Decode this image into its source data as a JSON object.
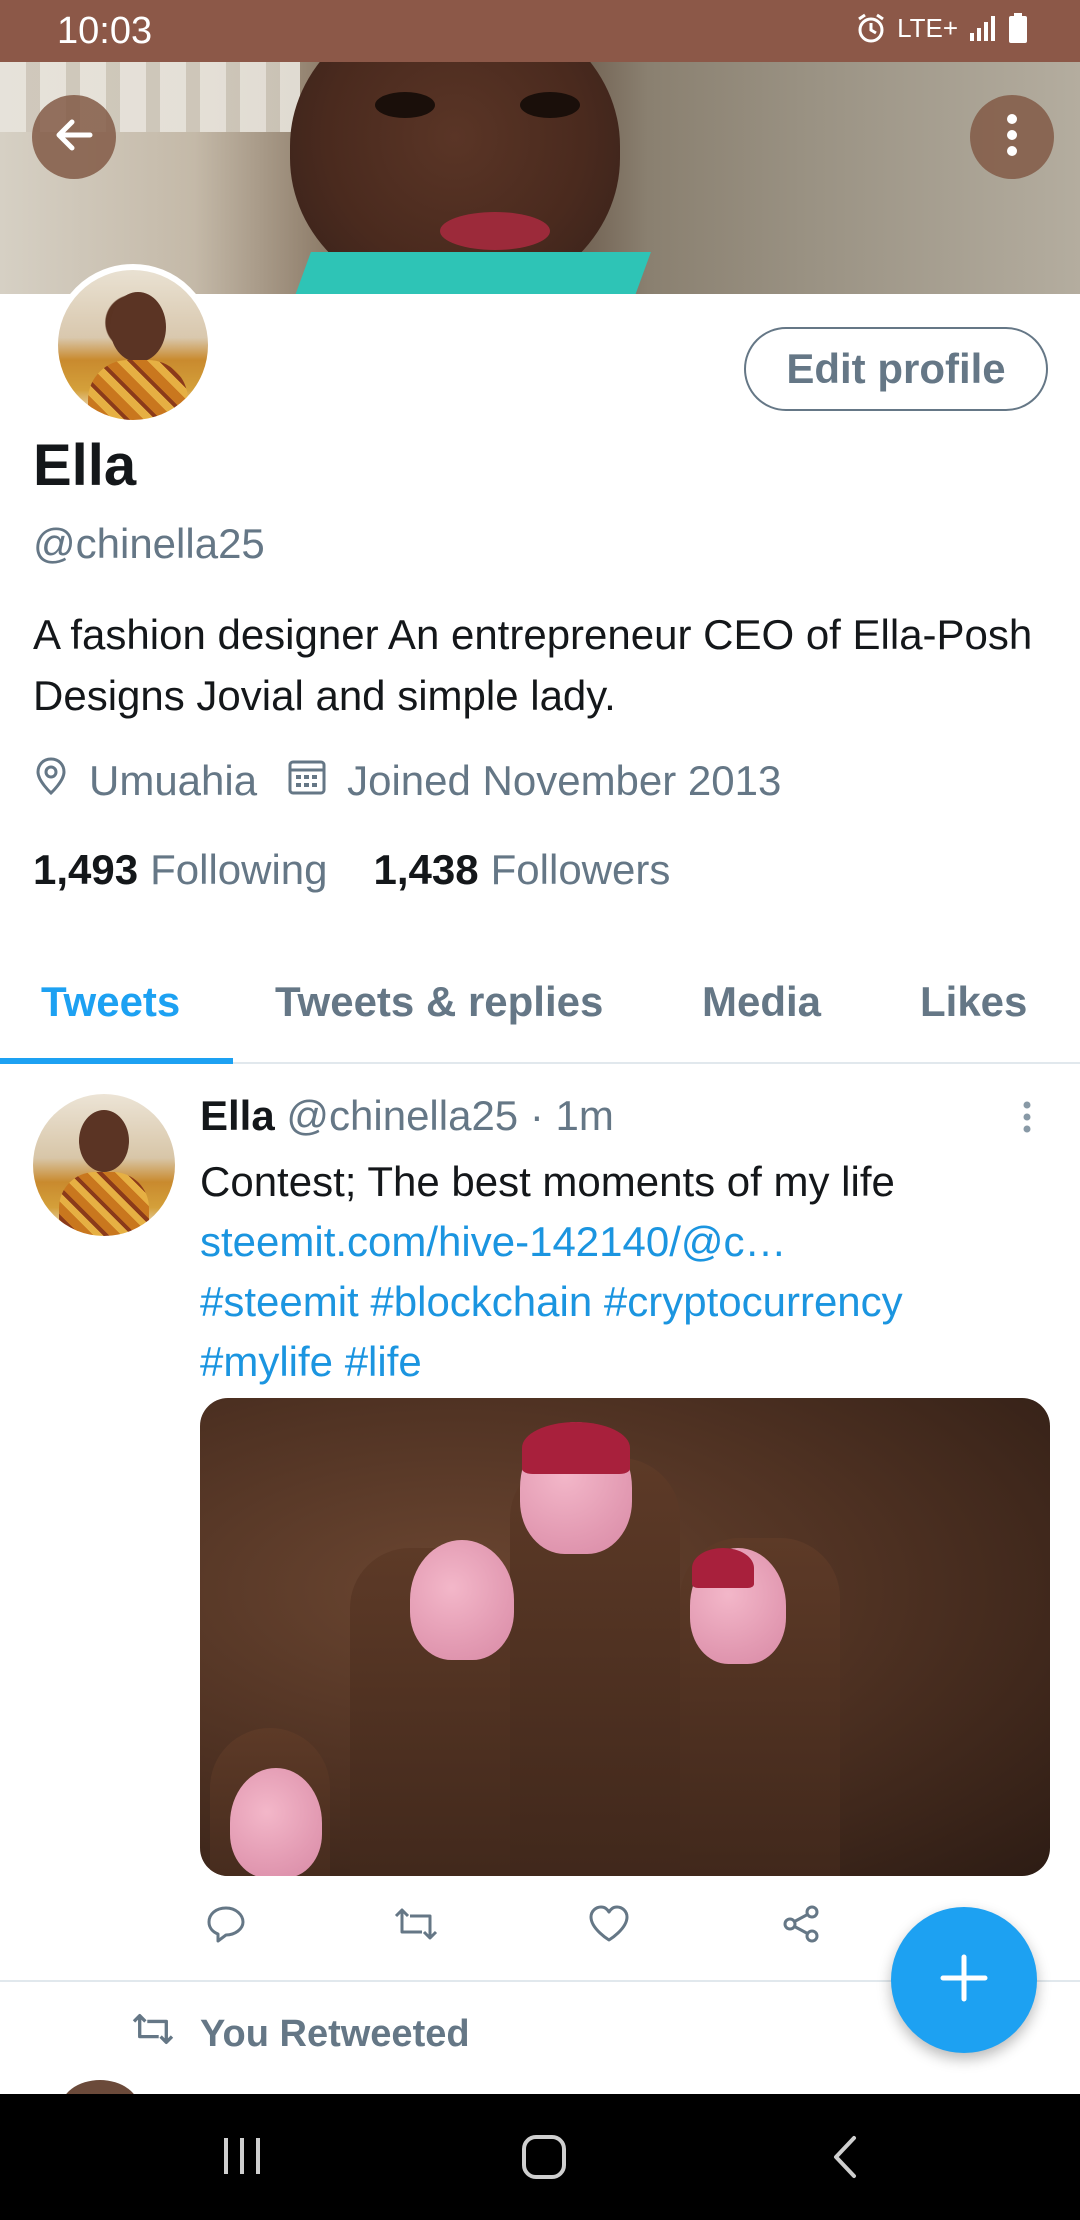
{
  "status_bar": {
    "time": "10:03",
    "network": "LTE+",
    "icons": [
      "alarm-icon",
      "lte-icon",
      "signal-icon",
      "battery-icon"
    ]
  },
  "header": {
    "back_icon": "arrow-left-icon",
    "more_icon": "more-vertical-icon"
  },
  "profile": {
    "name": "Ella",
    "handle": "@chinella25",
    "bio": "A fashion designer An entrepreneur CEO of Ella-Posh Designs Jovial and simple lady.",
    "location": "Umuahia",
    "joined": "Joined November 2013",
    "following_count": "1,493",
    "following_label": "Following",
    "followers_count": "1,438",
    "followers_label": "Followers",
    "edit_button_label": "Edit profile"
  },
  "tabs": [
    {
      "label": "Tweets",
      "active": true
    },
    {
      "label": "Tweets & replies",
      "active": false
    },
    {
      "label": "Media",
      "active": false
    },
    {
      "label": "Likes",
      "active": false
    }
  ],
  "tweet": {
    "author_name": "Ella",
    "author_handle": "@chinella25",
    "separator": "·",
    "time": "1m",
    "text": "Contest; The best moments of my life",
    "link": "steemit.com/hive-142140/@c…",
    "hashtags_line1": "#steemit #blockchain #cryptocurrency",
    "hashtags_line2": "#mylife #life",
    "actions": [
      "reply-icon",
      "retweet-icon",
      "like-icon",
      "share-icon"
    ]
  },
  "retweet_notice": {
    "label": "You Retweeted"
  },
  "fab": {
    "icon": "compose-plus-icon"
  },
  "colors": {
    "accent": "#1da1f2",
    "link": "#1b95e0",
    "secondary_text": "#657786",
    "status_bar": "#8c5848"
  }
}
